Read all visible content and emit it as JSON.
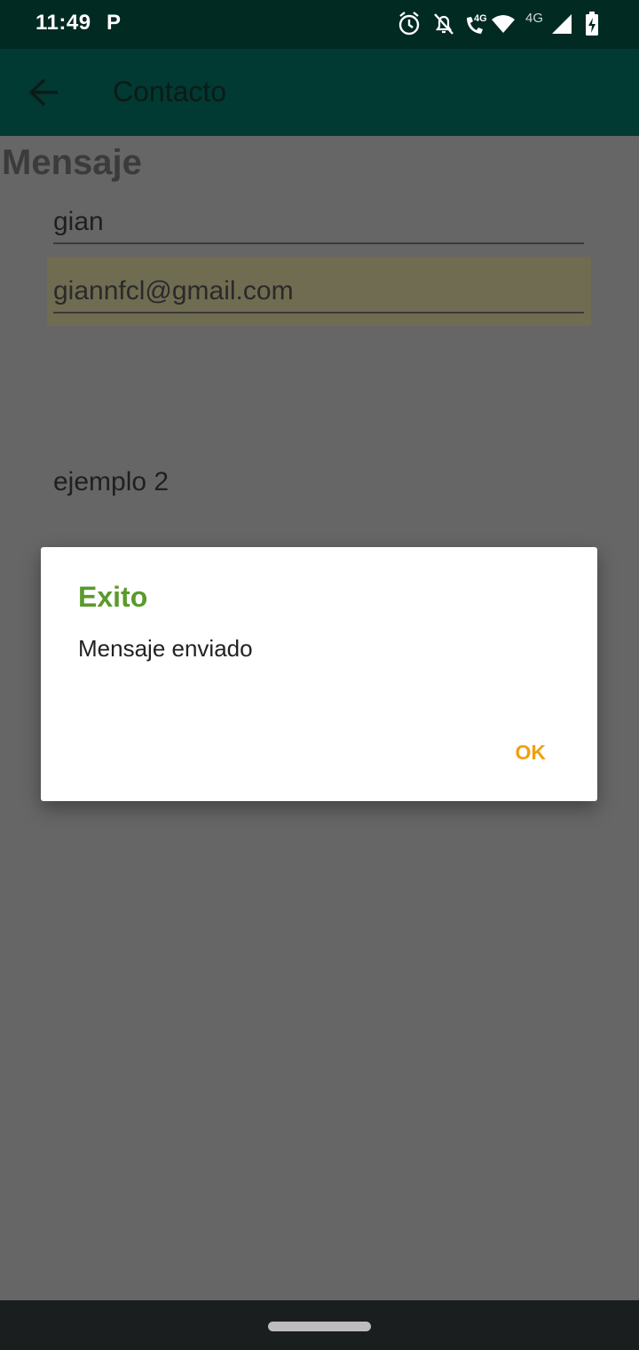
{
  "status_bar": {
    "time": "11:49",
    "icons": [
      "parking-icon",
      "alarm-icon",
      "notifications-off-icon",
      "volte-call-icon",
      "wifi-icon",
      "signal-4g-icon",
      "battery-charging-icon"
    ],
    "network_label_1": "4G",
    "network_label_2": "4G"
  },
  "app_bar": {
    "title": "Contacto",
    "back_icon": "arrow-back-icon"
  },
  "form": {
    "heading": "Mensaje",
    "name_value": "gian",
    "email_value": "giannfcl@gmail.com",
    "message_value": "ejemplo 2"
  },
  "dialog": {
    "title": "Exito",
    "message": "Mensaje enviado",
    "ok_label": "OK"
  },
  "colors": {
    "status_bar": "#002a22",
    "app_bar": "#003a32",
    "dialog_title": "#5a9a2c",
    "ok_button": "#f0a00f",
    "scrim": "#666666"
  }
}
